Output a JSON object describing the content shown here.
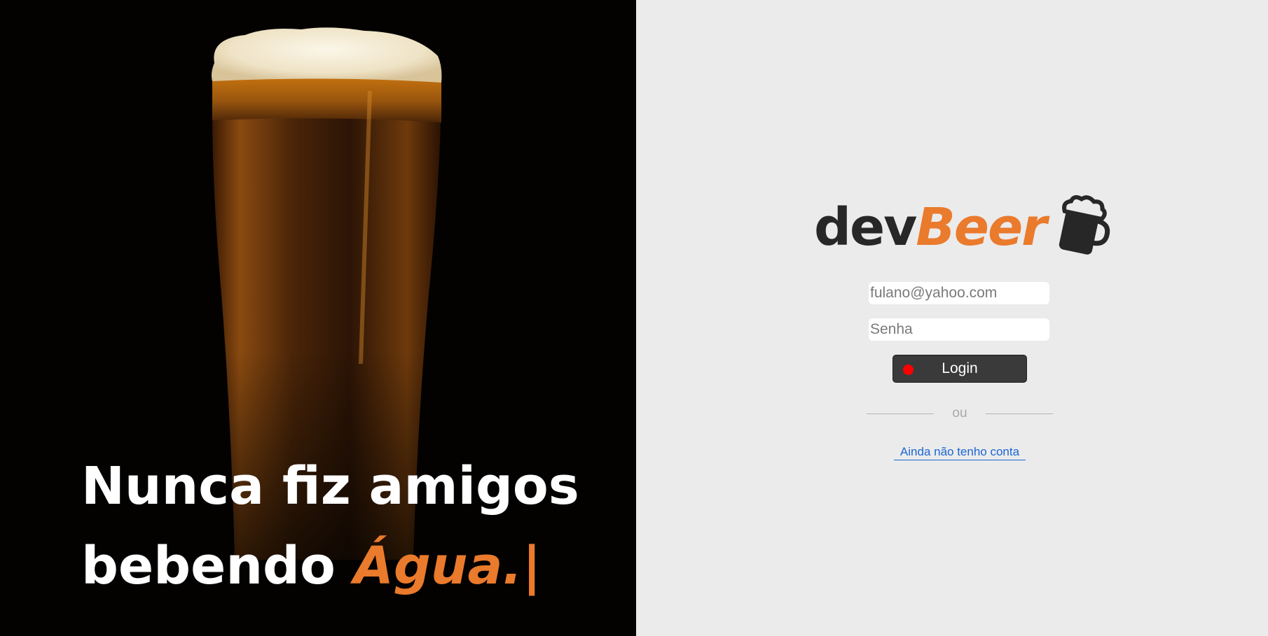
{
  "hero": {
    "line1": "Nunca fiz amigos",
    "line2_prefix": "bebendo ",
    "line2_accent": "Água.",
    "cursor": "|"
  },
  "logo": {
    "dev": "dev",
    "beer": "Beer",
    "icon": "beer-mug-icon"
  },
  "login_form": {
    "email_placeholder": "fulano@yahoo.com",
    "password_placeholder": "Senha",
    "login_label": "Login",
    "divider_label": "ou",
    "signup_link": "Ainda não tenho conta"
  },
  "colors": {
    "accent": "#ea7a2c",
    "logo_dark": "#272727",
    "panel_bg": "#ebebeb",
    "button_bg": "#3a3a3a",
    "status_dot": "#ff0000",
    "link": "#1a66d4"
  }
}
